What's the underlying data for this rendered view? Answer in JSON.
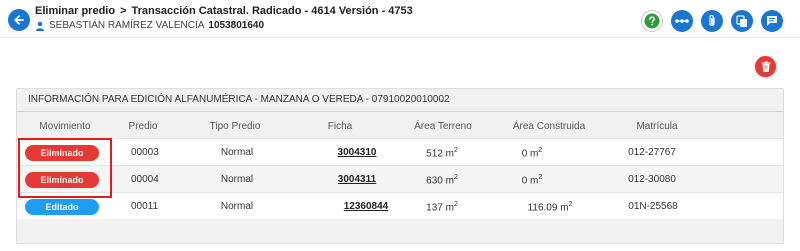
{
  "header": {
    "title_part1": "Eliminar predio",
    "title_sep": ">",
    "title_part2": "Transacción Catastral. Radicado - 4614 Versión - 4753",
    "user_name": "SEBASTIÁN RAMÍREZ VALENCIA",
    "user_id": "1053801640"
  },
  "panel": {
    "title": "INFORMACIÓN PARA EDICIÓN ALFANUMÉRICA - MANZANA O VEREDA - 07910020010002"
  },
  "table": {
    "columns": [
      "Movimiento",
      "Predio",
      "Tipo Predio",
      "Ficha",
      "Área Terreno",
      "Área Construida",
      "Matrícula"
    ],
    "rows": [
      {
        "movimiento": "Eliminado",
        "predio": "00003",
        "tipo": "Normal",
        "ficha": "3004310",
        "area_terreno": "512 m",
        "area_construida": "0 m",
        "matricula": "012-27767"
      },
      {
        "movimiento": "Eliminado",
        "predio": "00004",
        "tipo": "Normal",
        "ficha": "3004311",
        "area_terreno": "630 m",
        "area_construida": "0 m",
        "matricula": "012-30080"
      },
      {
        "movimiento": "Editado",
        "predio": "00011",
        "tipo": "Normal",
        "ficha": "12360844",
        "area_terreno": "137 m",
        "area_construida": "116.09 m",
        "matricula": "01N-25568"
      }
    ],
    "superscript": "2"
  },
  "colors": {
    "primary": "#1976d2",
    "eliminado": "#e53935",
    "editado": "#1e9df2",
    "help": "#2e9d3a",
    "highlight": "#e21b1b"
  },
  "icons": [
    "back-arrow-icon",
    "user-icon",
    "help-icon",
    "connections-icon",
    "attachment-icon",
    "copy-icon",
    "comment-icon",
    "delete-list-icon"
  ]
}
